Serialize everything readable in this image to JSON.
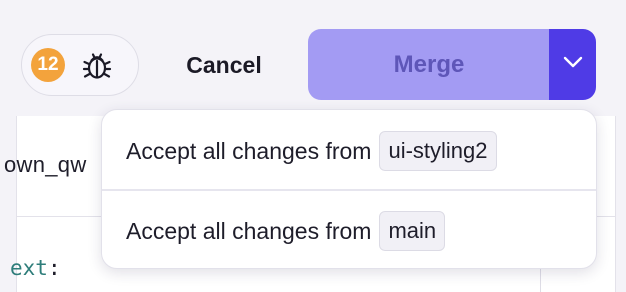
{
  "toolbar": {
    "issue_count": "12",
    "cancel_label": "Cancel",
    "merge_label": "Merge"
  },
  "editor": {
    "filename_fragment": "own_qw",
    "code_fragment": "ext",
    "code_punct": ":"
  },
  "merge_menu": {
    "items": [
      {
        "label": "Accept all changes from",
        "branch": "ui-styling2"
      },
      {
        "label": "Accept all changes from",
        "branch": "main"
      }
    ]
  },
  "colors": {
    "merge_button": "#a39bf3",
    "merge_caret": "#4f3be6",
    "issue_badge": "#f3a33c"
  },
  "icons": {
    "issues": "bug-icon",
    "merge_options": "chevron-down-icon"
  }
}
